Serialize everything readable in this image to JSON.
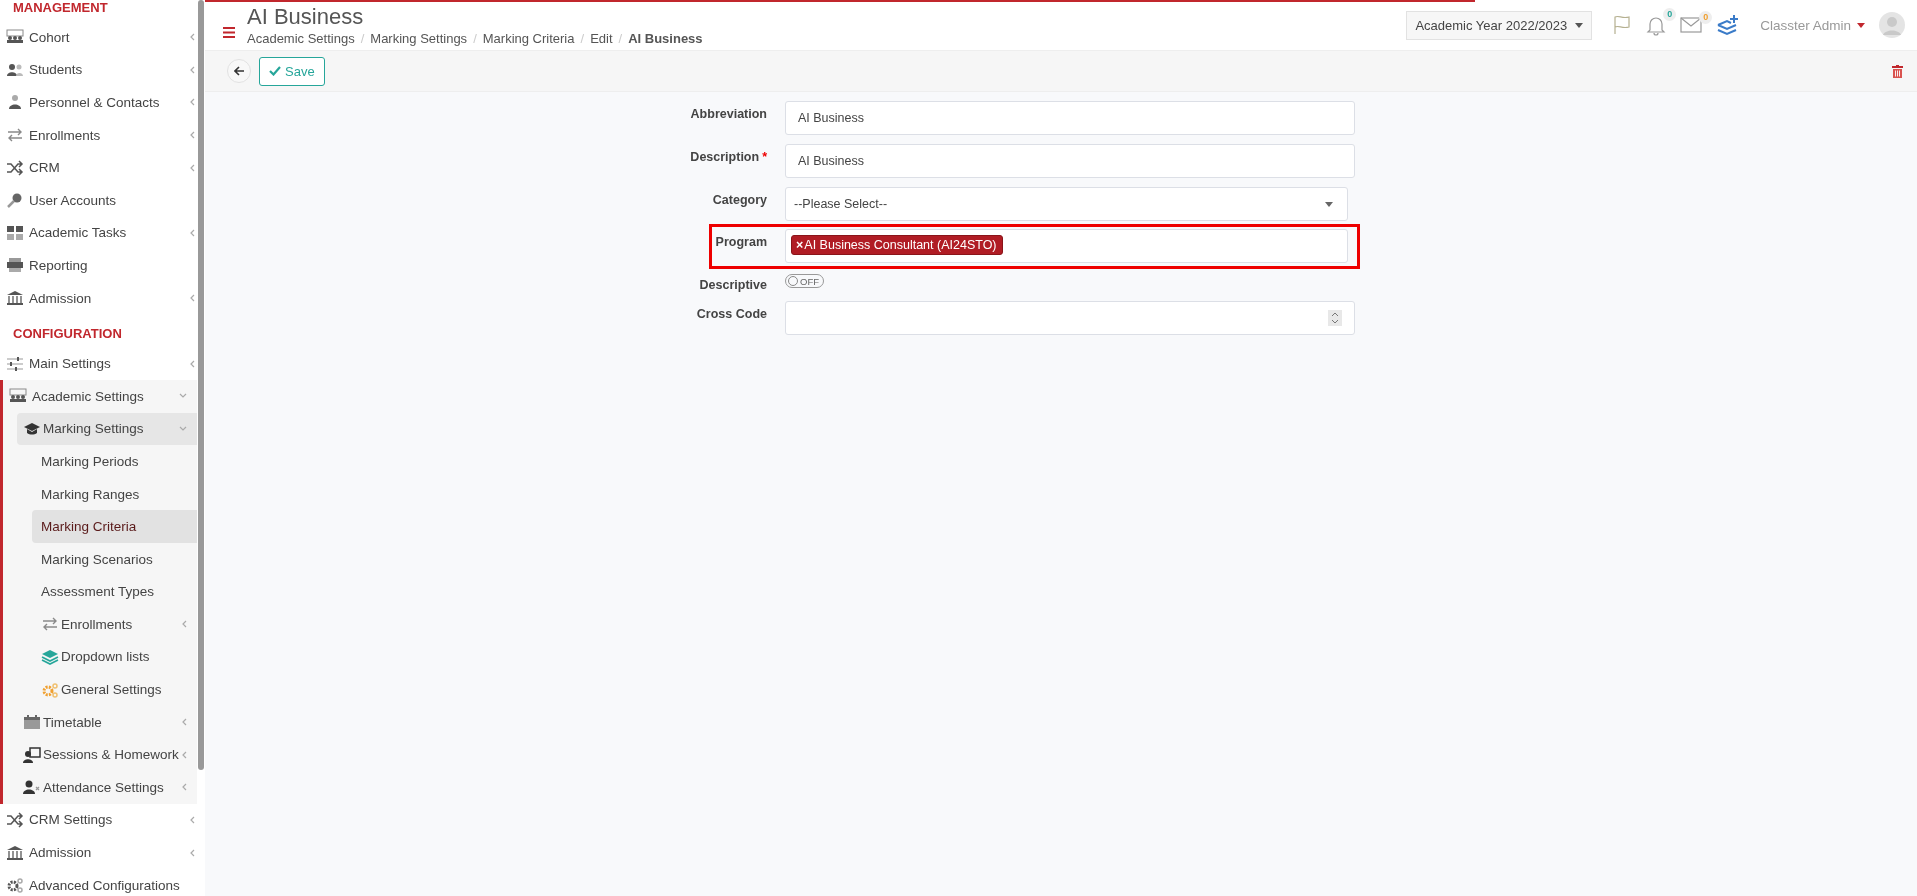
{
  "sidebar": {
    "sections": [
      {
        "heading": "MANAGEMENT",
        "items": [
          {
            "label": "Cohort",
            "expandable": true,
            "expanded": false,
            "selected": false
          },
          {
            "label": "Students",
            "expandable": true,
            "expanded": false,
            "selected": false
          },
          {
            "label": "Personnel & Contacts",
            "expandable": true,
            "expanded": false,
            "selected": false
          },
          {
            "label": "Enrollments",
            "expandable": true,
            "expanded": false,
            "selected": false
          },
          {
            "label": "CRM",
            "expandable": true,
            "expanded": false,
            "selected": false
          },
          {
            "label": "User Accounts",
            "expandable": false,
            "expanded": false,
            "selected": false
          },
          {
            "label": "Academic Tasks",
            "expandable": true,
            "expanded": false,
            "selected": false
          },
          {
            "label": "Reporting",
            "expandable": false,
            "expanded": false,
            "selected": false
          },
          {
            "label": "Admission",
            "expandable": true,
            "expanded": false,
            "selected": false
          }
        ]
      },
      {
        "heading": "CONFIGURATION",
        "items": [
          {
            "label": "Main Settings",
            "expandable": true,
            "expanded": false,
            "selected": false
          },
          {
            "label": "Academic Settings",
            "expandable": true,
            "expanded": true,
            "selected": false,
            "children": [
              {
                "label": "Marking Settings",
                "expandable": true,
                "expanded": true,
                "selected": false,
                "children": [
                  {
                    "label": "Marking Periods",
                    "expandable": false,
                    "expanded": false,
                    "selected": false
                  },
                  {
                    "label": "Marking Ranges",
                    "expandable": false,
                    "expanded": false,
                    "selected": false
                  },
                  {
                    "label": "Marking Criteria",
                    "expandable": false,
                    "expanded": false,
                    "selected": true
                  },
                  {
                    "label": "Marking Scenarios",
                    "expandable": false,
                    "expanded": false,
                    "selected": false
                  },
                  {
                    "label": "Assessment Types",
                    "expandable": false,
                    "expanded": false,
                    "selected": false
                  },
                  {
                    "label": "Enrollments",
                    "expandable": true,
                    "expanded": false,
                    "selected": false
                  },
                  {
                    "label": "Dropdown lists",
                    "expandable": false,
                    "expanded": false,
                    "selected": false
                  },
                  {
                    "label": "General Settings",
                    "expandable": false,
                    "expanded": false,
                    "selected": false
                  }
                ]
              },
              {
                "label": "Timetable",
                "expandable": true,
                "expanded": false,
                "selected": false
              },
              {
                "label": "Sessions & Homework",
                "expandable": true,
                "expanded": false,
                "selected": false
              },
              {
                "label": "Attendance Settings",
                "expandable": true,
                "expanded": false,
                "selected": false
              }
            ]
          },
          {
            "label": "CRM Settings",
            "expandable": true,
            "expanded": false,
            "selected": false
          },
          {
            "label": "Admission",
            "expandable": true,
            "expanded": false,
            "selected": false
          },
          {
            "label": "Advanced Configurations",
            "expandable": false,
            "expanded": false,
            "selected": false
          }
        ]
      }
    ]
  },
  "header": {
    "title": "AI Business",
    "breadcrumb": [
      {
        "label": "Academic Settings"
      },
      {
        "separator": "/",
        "label": "Marking Settings"
      },
      {
        "separator": "/",
        "label": "Marking Criteria"
      },
      {
        "separator": "/",
        "label": "Edit"
      },
      {
        "separator": "/",
        "label": "AI Business"
      }
    ],
    "academic_year": "Academic Year 2022/2023",
    "notifications_count": "0",
    "messages_count": "0",
    "user": "Classter Admin"
  },
  "toolbar": {
    "save": "Save"
  },
  "form": {
    "fields": [
      {
        "kind": "text",
        "label": "Abbreviation",
        "highlighted": false,
        "value": "AI Business"
      },
      {
        "kind": "text",
        "label": "Description",
        "required_mark": "*",
        "highlighted": false,
        "value": "AI Business"
      },
      {
        "kind": "select",
        "label": "Category",
        "highlighted": false,
        "value": "--Please Select--"
      },
      {
        "kind": "tags",
        "label": "Program",
        "highlighted": true,
        "tags": [
          {
            "remove": "×",
            "label": "AI Business Consultant (AI24STO)"
          }
        ]
      },
      {
        "kind": "toggle",
        "label": "Descriptive",
        "highlighted": false,
        "on": false,
        "state_label": "OFF"
      },
      {
        "kind": "number",
        "label": "Cross Code",
        "highlighted": false
      }
    ]
  }
}
